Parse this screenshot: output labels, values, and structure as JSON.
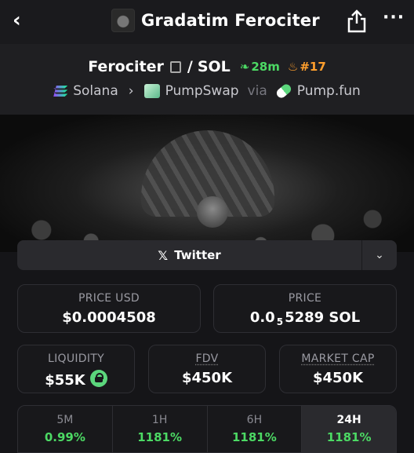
{
  "header": {
    "title": "Gradatim Ferociter"
  },
  "pair": {
    "base": "Ferociter",
    "quote": "SOL",
    "age": "28m",
    "rank": "#17",
    "chain": "Solana",
    "dex": "PumpSwap",
    "via_label": "via",
    "launchpad": "Pump.fun"
  },
  "social": {
    "twitter_label": "Twitter"
  },
  "stats": {
    "price_usd_label": "PRICE USD",
    "price_usd": "$0.0004508",
    "price_label": "PRICE",
    "price_prefix": "0.0",
    "price_sub": "5",
    "price_suffix": "5289 SOL",
    "liquidity_label": "LIQUIDITY",
    "liquidity": "$55K",
    "fdv_label": "FDV",
    "fdv": "$450K",
    "mcap_label": "MARKET CAP",
    "mcap": "$450K"
  },
  "timeframes": [
    {
      "label": "5M",
      "change": "0.99%"
    },
    {
      "label": "1H",
      "change": "1181%"
    },
    {
      "label": "6H",
      "change": "1181%"
    },
    {
      "label": "24H",
      "change": "1181%",
      "active": true
    }
  ],
  "colors": {
    "positive": "#4cd964",
    "rank": "#ff9f2d",
    "background": "#151518"
  }
}
